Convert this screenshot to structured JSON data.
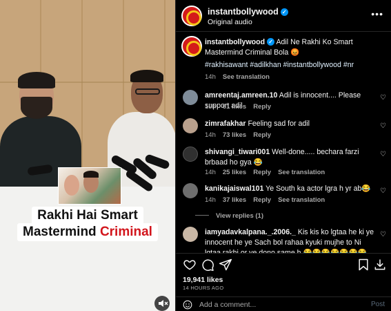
{
  "video": {
    "caption_line1": "Rakhi Hai Smart",
    "caption_line2_a": "Mastermind ",
    "caption_line2_b": "Criminal"
  },
  "header": {
    "username": "instantbollywood",
    "subtitle": "Original audio"
  },
  "post": {
    "username": "instantbollywood",
    "text": "Adil Ne Rakhi Ko Smart Mastermind Criminal Bola 😡",
    "hashtags": "#rakhisawant #adilkhan #instantbollywood #nr",
    "time": "14h",
    "see_translation": "See translation"
  },
  "comments": [
    {
      "user": "amreentaj.amreen.10",
      "text": "Adil is innocent.... Please support adil",
      "time": "13h",
      "likes": "61 likes",
      "reply": "Reply",
      "avatar_color": "#7f8c99"
    },
    {
      "user": "zimrafakhar",
      "text": "Feeling sad for adil",
      "time": "14h",
      "likes": "73 likes",
      "reply": "Reply",
      "avatar_color": "#b9a08c"
    },
    {
      "user": "shivangi_tiwari001",
      "text": "Well-done..... bechara farzi brbaad ho gya 😂",
      "time": "14h",
      "likes": "25 likes",
      "reply": "Reply",
      "see_translation": "See translation",
      "avatar_color": "#303030"
    },
    {
      "user": "kanikajaiswal101",
      "text": "Ye South ka actor lgra h yr ab😂",
      "time": "14h",
      "likes": "37 likes",
      "reply": "Reply",
      "see_translation": "See translation",
      "view_replies": "View replies (1)",
      "avatar_color": "#6e6e6e"
    },
    {
      "user": "iamyadavkalpana._.2006._",
      "text": "Kis kis ko lgtaa he ki ye innocent he ye Sach bol rahaa kyuki mujhe to Ni lgtaa rakhi or ye dono same h 😂😂😂😂😂😂😂😂",
      "avatar_color": "#c9b7a5"
    }
  ],
  "footer": {
    "likes": "19,941 likes",
    "time_ago": "14 HOURS AGO",
    "add_comment_placeholder": "Add a comment...",
    "post_label": "Post"
  },
  "colors": {
    "accent": "#0095f6",
    "background": "#000000",
    "caption_red": "#d2151c"
  },
  "icons": [
    "heart-icon",
    "comment-icon",
    "share-icon",
    "bookmark-icon",
    "download-icon",
    "emoji-icon",
    "more-icon",
    "verified-icon",
    "mute-icon"
  ]
}
